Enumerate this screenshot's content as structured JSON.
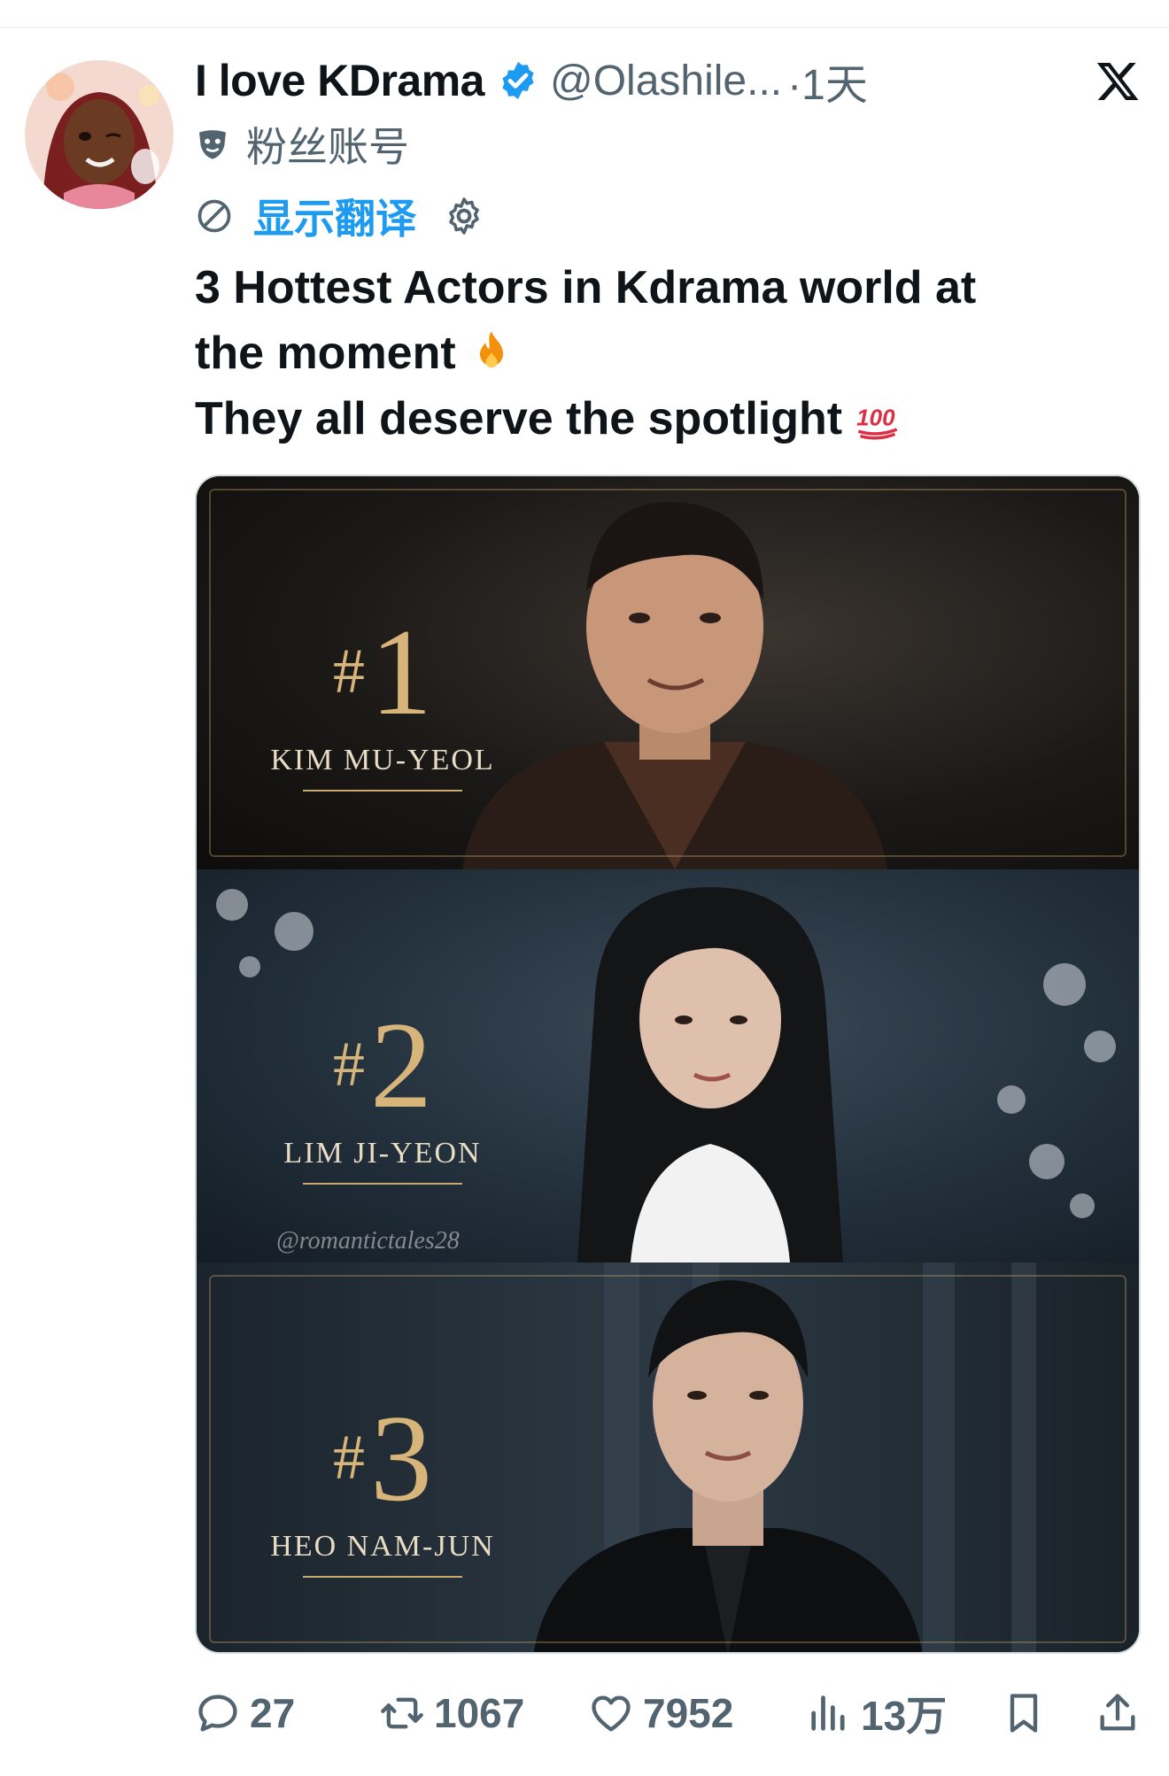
{
  "tweet": {
    "display_name": "I love KDrama",
    "handle": "@Olashile...",
    "time": "·1天",
    "fan_label": "粉丝账号",
    "translate_label": "显示翻译",
    "text_lines": [
      "3 Hottest Actors in Kdrama world at",
      "the moment",
      "They all deserve the spotlight"
    ]
  },
  "media": {
    "watermark": "@romantictales28",
    "ranks": [
      {
        "hash": "#",
        "number": "1",
        "name": "KIM MU-YEOL"
      },
      {
        "hash": "#",
        "number": "2",
        "name": "LIM JI-YEON"
      },
      {
        "hash": "#",
        "number": "3",
        "name": "HEO NAM-JUN"
      }
    ]
  },
  "actions": {
    "replies": "27",
    "retweets": "1067",
    "likes": "7952",
    "views": "13万"
  },
  "colors": {
    "link": "#1d9bf0",
    "muted": "#536471",
    "gold": "#d7b47a",
    "verified": "#1d9bf0"
  },
  "icons": [
    "verified-badge-icon",
    "x-logo-icon",
    "theater-mask-icon",
    "translate-globe-icon",
    "gear-icon",
    "fire-emoji",
    "hundred-emoji",
    "reply-icon",
    "retweet-icon",
    "like-icon",
    "views-icon",
    "bookmark-icon",
    "share-icon"
  ]
}
